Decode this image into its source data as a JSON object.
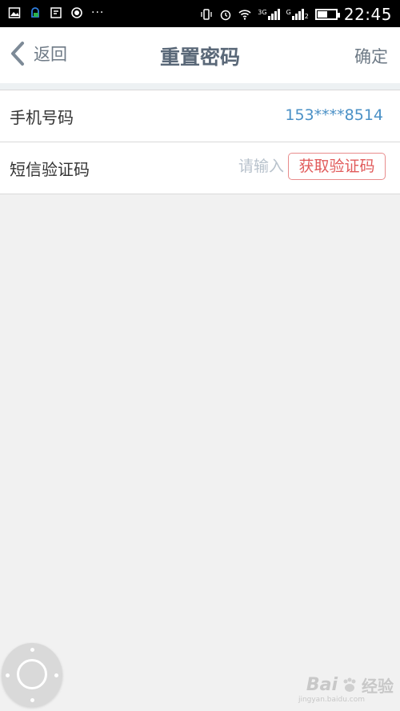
{
  "status_bar": {
    "time": "22:45",
    "dots": "···",
    "signal_1": "3G",
    "signal_2": "G",
    "sim2": "2"
  },
  "navbar": {
    "back_label": "返回",
    "title": "重置密码",
    "confirm_label": "确定"
  },
  "form": {
    "phone_label": "手机号码",
    "phone_value": "153****8514",
    "sms_label": "短信验证码",
    "sms_placeholder": "请输入",
    "get_code_label": "获取验证码"
  },
  "watermark": {
    "brand": "Bai",
    "brand2": "经验",
    "url": "jingyan.baidu.com"
  },
  "colors": {
    "accent_link": "#4a90c6",
    "code_button": "#e15b5b",
    "nav_text": "#6e7a86"
  }
}
